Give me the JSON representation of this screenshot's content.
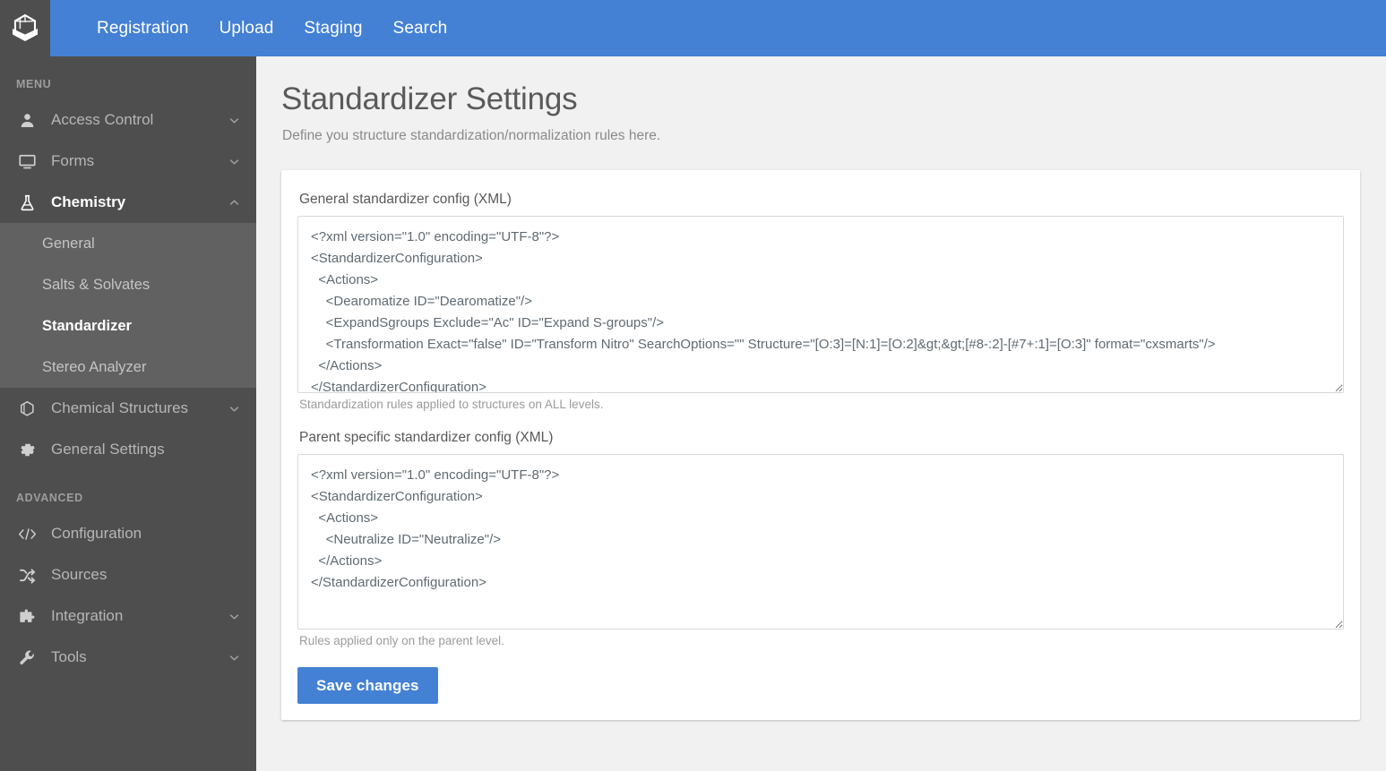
{
  "header": {
    "logo_icon": "cube-box-logo",
    "nav": [
      {
        "label": "Registration"
      },
      {
        "label": "Upload"
      },
      {
        "label": "Staging"
      },
      {
        "label": "Search"
      }
    ]
  },
  "sidebar": {
    "menu_title": "MENU",
    "advanced_title": "ADVANCED",
    "items": [
      {
        "label": "Access Control",
        "icon": "user-icon",
        "caret": "chevron-down-icon"
      },
      {
        "label": "Forms",
        "icon": "monitor-icon",
        "caret": "chevron-down-icon"
      },
      {
        "label": "Chemistry",
        "icon": "flask-icon",
        "caret": "chevron-up-icon",
        "active": true
      }
    ],
    "chemistry_submenu": [
      {
        "label": "General"
      },
      {
        "label": "Salts & Solvates"
      },
      {
        "label": "Standardizer",
        "active": true
      },
      {
        "label": "Stereo Analyzer"
      }
    ],
    "items_after": [
      {
        "label": "Chemical Structures",
        "icon": "hexagon-icon",
        "caret": "chevron-down-icon"
      },
      {
        "label": "General Settings",
        "icon": "gear-icon",
        "caret": ""
      }
    ],
    "advanced_items": [
      {
        "label": "Configuration",
        "icon": "code-icon",
        "caret": ""
      },
      {
        "label": "Sources",
        "icon": "shuffle-icon",
        "caret": ""
      },
      {
        "label": "Integration",
        "icon": "puzzle-icon",
        "caret": "chevron-down-icon"
      },
      {
        "label": "Tools",
        "icon": "wrench-icon",
        "caret": "chevron-down-icon"
      }
    ]
  },
  "main": {
    "title": "Standardizer Settings",
    "subtitle": "Define you structure standardization/normalization rules here.",
    "general_field": {
      "label": "General standardizer config (XML)",
      "value": "<?xml version=\"1.0\" encoding=\"UTF-8\"?>\n<StandardizerConfiguration>\n  <Actions>\n    <Dearomatize ID=\"Dearomatize\"/>\n    <ExpandSgroups Exclude=\"Ac\" ID=\"Expand S-groups\"/>\n    <Transformation Exact=\"false\" ID=\"Transform Nitro\" SearchOptions=\"\" Structure=\"[O:3]=[N:1]=[O:2]&gt;&gt;[#8-:2]-[#7+:1]=[O:3]\" format=\"cxsmarts\"/>\n  </Actions>\n</StandardizerConfiguration>",
      "help": "Standardization rules applied to structures on ALL levels."
    },
    "parent_field": {
      "label": "Parent specific standardizer config (XML)",
      "value": "<?xml version=\"1.0\" encoding=\"UTF-8\"?>\n<StandardizerConfiguration>\n  <Actions>\n    <Neutralize ID=\"Neutralize\"/>\n  </Actions>\n</StandardizerConfiguration>",
      "help": "Rules applied only on the parent level."
    },
    "save_label": "Save changes"
  },
  "colors": {
    "brand_blue": "#4481d4",
    "sidebar": "#4e4e4e",
    "submenu": "#616161",
    "page_bg": "#f1f1f1"
  }
}
